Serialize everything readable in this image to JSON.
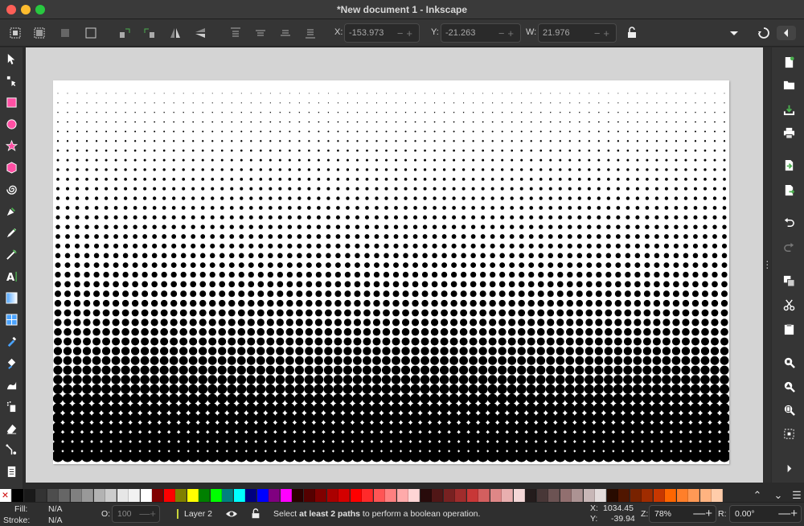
{
  "window": {
    "title": "*New document 1 - Inkscape"
  },
  "toolbar": {
    "x_label": "X:",
    "x_value": "-153.973",
    "y_label": "Y:",
    "y_value": "-21.263",
    "w_label": "W:",
    "w_value": "21.976",
    "plus_minus": "−+"
  },
  "canvas": {
    "page_color": "#ffffff",
    "desk_color": "#d4d4d4",
    "halftone_rows": 39,
    "halftone_cols": 70,
    "dot_color": "#000000"
  },
  "palette": {
    "swatches": [
      "#000000",
      "#1a1a1a",
      "#333333",
      "#4d4d4d",
      "#666666",
      "#808080",
      "#999999",
      "#b3b3b3",
      "#cccccc",
      "#e6e6e6",
      "#f2f2f2",
      "#ffffff",
      "#800000",
      "#ff0000",
      "#808000",
      "#ffff00",
      "#008000",
      "#00ff00",
      "#008080",
      "#00ffff",
      "#000080",
      "#0000ff",
      "#800080",
      "#ff00ff",
      "#2b0000",
      "#550000",
      "#800000",
      "#aa0000",
      "#d40000",
      "#ff0000",
      "#ff2a2a",
      "#ff5555",
      "#ff8080",
      "#ffaaaa",
      "#ffd5d5",
      "#280b0b",
      "#501616",
      "#782121",
      "#a02c2c",
      "#c83737",
      "#d35f5f",
      "#de8787",
      "#e9afaf",
      "#f4d7d7",
      "#241c1c",
      "#483737",
      "#6c5353",
      "#916f6f",
      "#ac9393",
      "#c8b7b7",
      "#e3dbdb",
      "#280b00",
      "#501600",
      "#782200",
      "#a02c00",
      "#c83700",
      "#ff6600",
      "#ff7f2a",
      "#ff9955",
      "#ffb380",
      "#ffccaa"
    ],
    "none_label": "×"
  },
  "status": {
    "fill_label": "Fill:",
    "fill_value": "N/A",
    "stroke_label": "Stroke:",
    "stroke_value": "N/A",
    "opacity_label": "O:",
    "opacity_value": "100",
    "layer_name": "Layer 2",
    "message_pre": "Select ",
    "message_bold": "at least 2 paths",
    "message_post": " to perform a boolean operation.",
    "cursor_x_label": "X:",
    "cursor_x": "1034.45",
    "cursor_y_label": "Y:",
    "cursor_y": "-39.94",
    "zoom_label": "Z:",
    "zoom_value": "78%",
    "rotate_label": "R:",
    "rotate_value": "0.00°"
  },
  "icons": {
    "left": [
      "selector-icon",
      "node-icon",
      "rect-icon",
      "circle-icon",
      "star-icon",
      "box3d-icon",
      "spiral-icon",
      "pen-icon",
      "pencil-icon",
      "calligraphy-icon",
      "text-icon",
      "gradient-icon",
      "mesh-icon",
      "dropper-icon",
      "paint-bucket-icon",
      "tweak-icon",
      "spray-icon",
      "eraser-icon",
      "connector-icon",
      "pages-icon"
    ],
    "right": [
      "new-doc-icon",
      "open-icon",
      "save-icon",
      "print-icon",
      "import-icon",
      "export-icon",
      "undo-icon",
      "redo-icon",
      "copy-icon",
      "cut-icon",
      "paste-icon",
      "zoom-selection-icon",
      "zoom-drawing-icon",
      "zoom-page-icon",
      "zoom-center-icon",
      "expand-icon"
    ]
  }
}
